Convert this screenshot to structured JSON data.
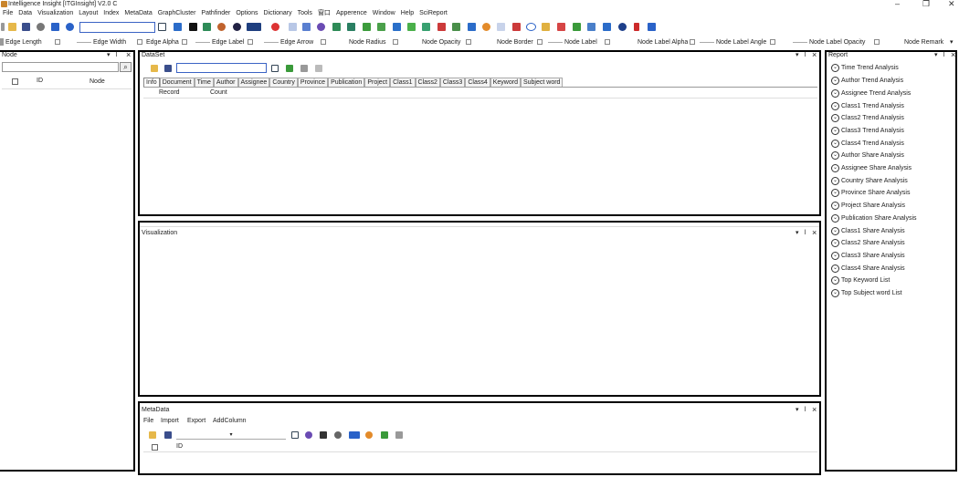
{
  "window": {
    "title": "Intelligence Insight [ITGInsight] V2.0 C",
    "controls": [
      "–",
      "❐",
      "✕"
    ]
  },
  "menubar": [
    "File",
    "Data",
    "Visualization",
    "Layout",
    "Index",
    "MetaData",
    "GraphCluster",
    "Pathfinder",
    "Options",
    "Dictionary",
    "Tools",
    "窗口",
    "Apperence",
    "Window",
    "Help",
    "SciReport"
  ],
  "toolbar": {
    "search_value": ""
  },
  "propbar": [
    "Edge Length",
    "Edge Width",
    "Edge Alpha",
    "Edge Label",
    "Edge Arrow",
    "Node Radius",
    "Node Opacity",
    "Node Border",
    "Node Label",
    "Node Label Alpha",
    "Node Label Angle",
    "Node Label Opacity",
    "Node Remark"
  ],
  "node_panel": {
    "title": "Node",
    "search_value": "",
    "columns": [
      "ID",
      "Node"
    ]
  },
  "dataset_panel": {
    "title": "DataSet",
    "search_value": "",
    "tabs": [
      "Info",
      "Document",
      "Time",
      "Author",
      "Assignee",
      "Country",
      "Province",
      "Publication",
      "Project",
      "Class1",
      "Class2",
      "Class3",
      "Class4",
      "Keyword",
      "Subject word"
    ],
    "active_tab": "Info",
    "columns": [
      "Record",
      "Count"
    ]
  },
  "visualization_panel": {
    "title": "Visualization"
  },
  "metadata_panel": {
    "title": "MetaData",
    "menu": [
      "File",
      "Import",
      "Export",
      "AddColumn"
    ],
    "columns": [
      "ID"
    ]
  },
  "report_panel": {
    "title": "Report",
    "items": [
      "Time Trend Analysis",
      "Author Trend Analysis",
      "Assignee Trend Analysis",
      "Class1 Trend Analysis",
      "Class2 Trend Analysis",
      "Class3 Trend Analysis",
      "Class4 Trend Analysis",
      "Author Share Analysis",
      "Assignee Share Analysis",
      "Country Share Analysis",
      "Province Share Analysis",
      "Project Share Analysis",
      "Publication Share Analysis",
      "Class1 Share Analysis",
      "Class2 Share Analysis",
      "Class3 Share Analysis",
      "Class4 Share Analysis",
      "Top Keyword List",
      "Top Subject word List"
    ]
  },
  "colors": {
    "accent_border": "#000000",
    "search_border": "#3b63c4"
  }
}
